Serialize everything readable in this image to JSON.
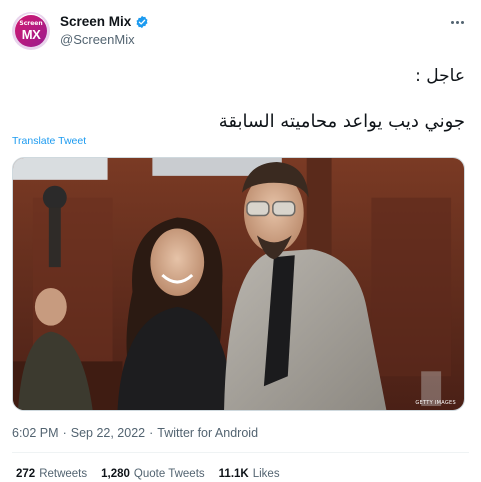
{
  "author": {
    "display_name": "Screen Mix",
    "handle": "@ScreenMix",
    "avatar_text": "MX",
    "avatar_top_text": "Screen",
    "verified_icon": "verified-badge-icon",
    "brand_color": "#d1196f"
  },
  "tweet": {
    "line1": "عاجل :",
    "line2": "جوني ديب يواعد محاميته السابقة",
    "translate_label": "Translate Tweet",
    "media_icon": "courtroom-photo",
    "media_credit": "GETTY IMAGES"
  },
  "meta": {
    "time": "6:02 PM",
    "sep1": "·",
    "date": "Sep 22, 2022",
    "sep2": "·",
    "source": "Twitter for Android"
  },
  "stats": {
    "retweets_count": "272",
    "retweets_label": "Retweets",
    "quotes_count": "1,280",
    "quotes_label": "Quote Tweets",
    "likes_count": "11.1K",
    "likes_label": "Likes"
  },
  "colors": {
    "link": "#1d9bf0",
    "secondary_text": "#536471",
    "primary_text": "#0f1419"
  }
}
